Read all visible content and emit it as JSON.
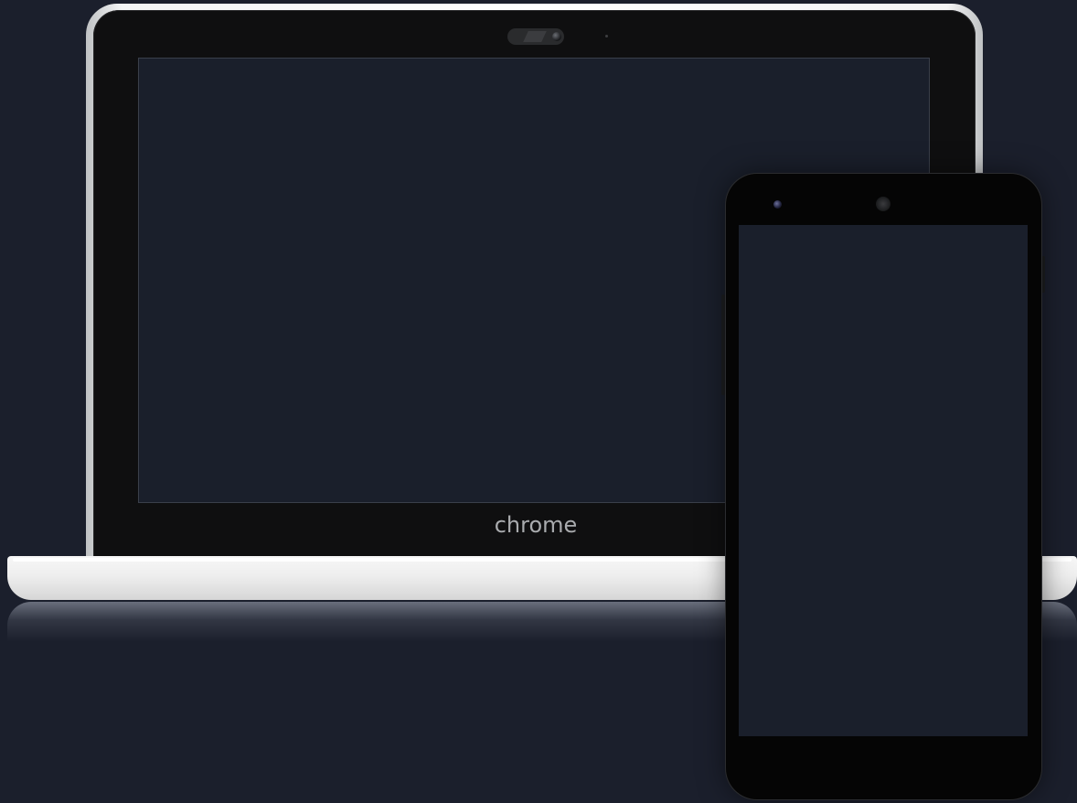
{
  "laptop": {
    "brand_label": "chrome"
  },
  "colors": {
    "background": "#1b1f2c",
    "laptop_shell": "#f2f2f2",
    "bezel": "#0f0f10",
    "screen": "#1a1f2b",
    "phone_body": "#050505"
  },
  "icons": {
    "laptop_webcam": "webcam-icon",
    "phone_camera": "front-camera-icon",
    "phone_speaker": "earpiece-speaker-icon"
  }
}
